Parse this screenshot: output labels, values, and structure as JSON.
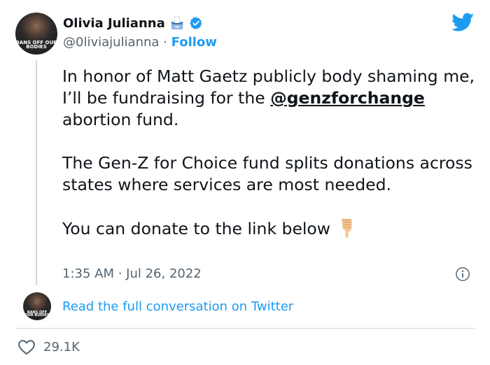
{
  "author": {
    "display_name": "Olivia Julianna",
    "handle": "@0liviajulianna",
    "separator": "·",
    "follow_label": "Follow",
    "avatar_shirt_text": "BANS OFF OUR BODIES"
  },
  "tweet": {
    "line1_prefix": "In honor of Matt Gaetz publicly body shaming me, I’ll be fundraising for the",
    "mention": "@genzforchange",
    "line1_suffix": " abortion fund.",
    "paragraph2": "The Gen-Z for Choice fund splits donations across states where services are most needed.",
    "paragraph3": "You can donate to the link below",
    "timestamp": "1:35 AM · Jul 26, 2022"
  },
  "read_more_label": "Read the full conversation on Twitter",
  "likes": {
    "count": "29.1K"
  },
  "icons": {
    "brand": "twitter-bird-icon",
    "verified": "verified-badge-icon",
    "emoji": "ballot-box-emoji-icon",
    "pointing": "pointing-down-emoji-icon",
    "info": "info-icon",
    "like": "heart-icon"
  },
  "colors": {
    "accent": "#1d9bf0",
    "text": "#0f1419",
    "secondary": "#536471",
    "divider": "#cfd9de"
  }
}
